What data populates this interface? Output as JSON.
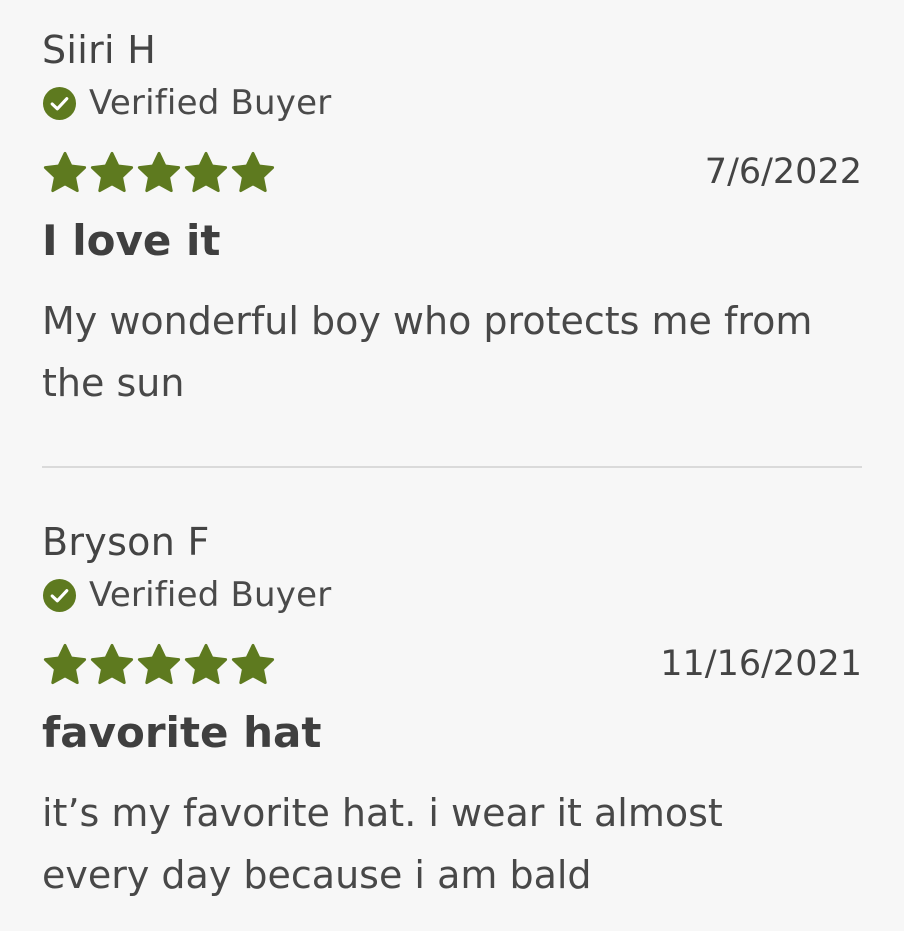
{
  "colors": {
    "accent_green": "#5e7a1f",
    "background": "#f7f7f7",
    "text": "#3f3f3f",
    "divider": "#dadada"
  },
  "reviews": [
    {
      "author": "Siiri H",
      "verified_label": "Verified Buyer",
      "verified_icon": "check-circle-icon",
      "rating": 5,
      "rating_max": 5,
      "date": "7/6/2022",
      "title": "I love it",
      "body": "My wonderful boy who protects me from the sun"
    },
    {
      "author": "Bryson F",
      "verified_label": "Verified Buyer",
      "verified_icon": "check-circle-icon",
      "rating": 5,
      "rating_max": 5,
      "date": "11/16/2021",
      "title": "favorite hat",
      "body": "it’s my favorite hat. i wear it almost every day because i am bald"
    }
  ]
}
